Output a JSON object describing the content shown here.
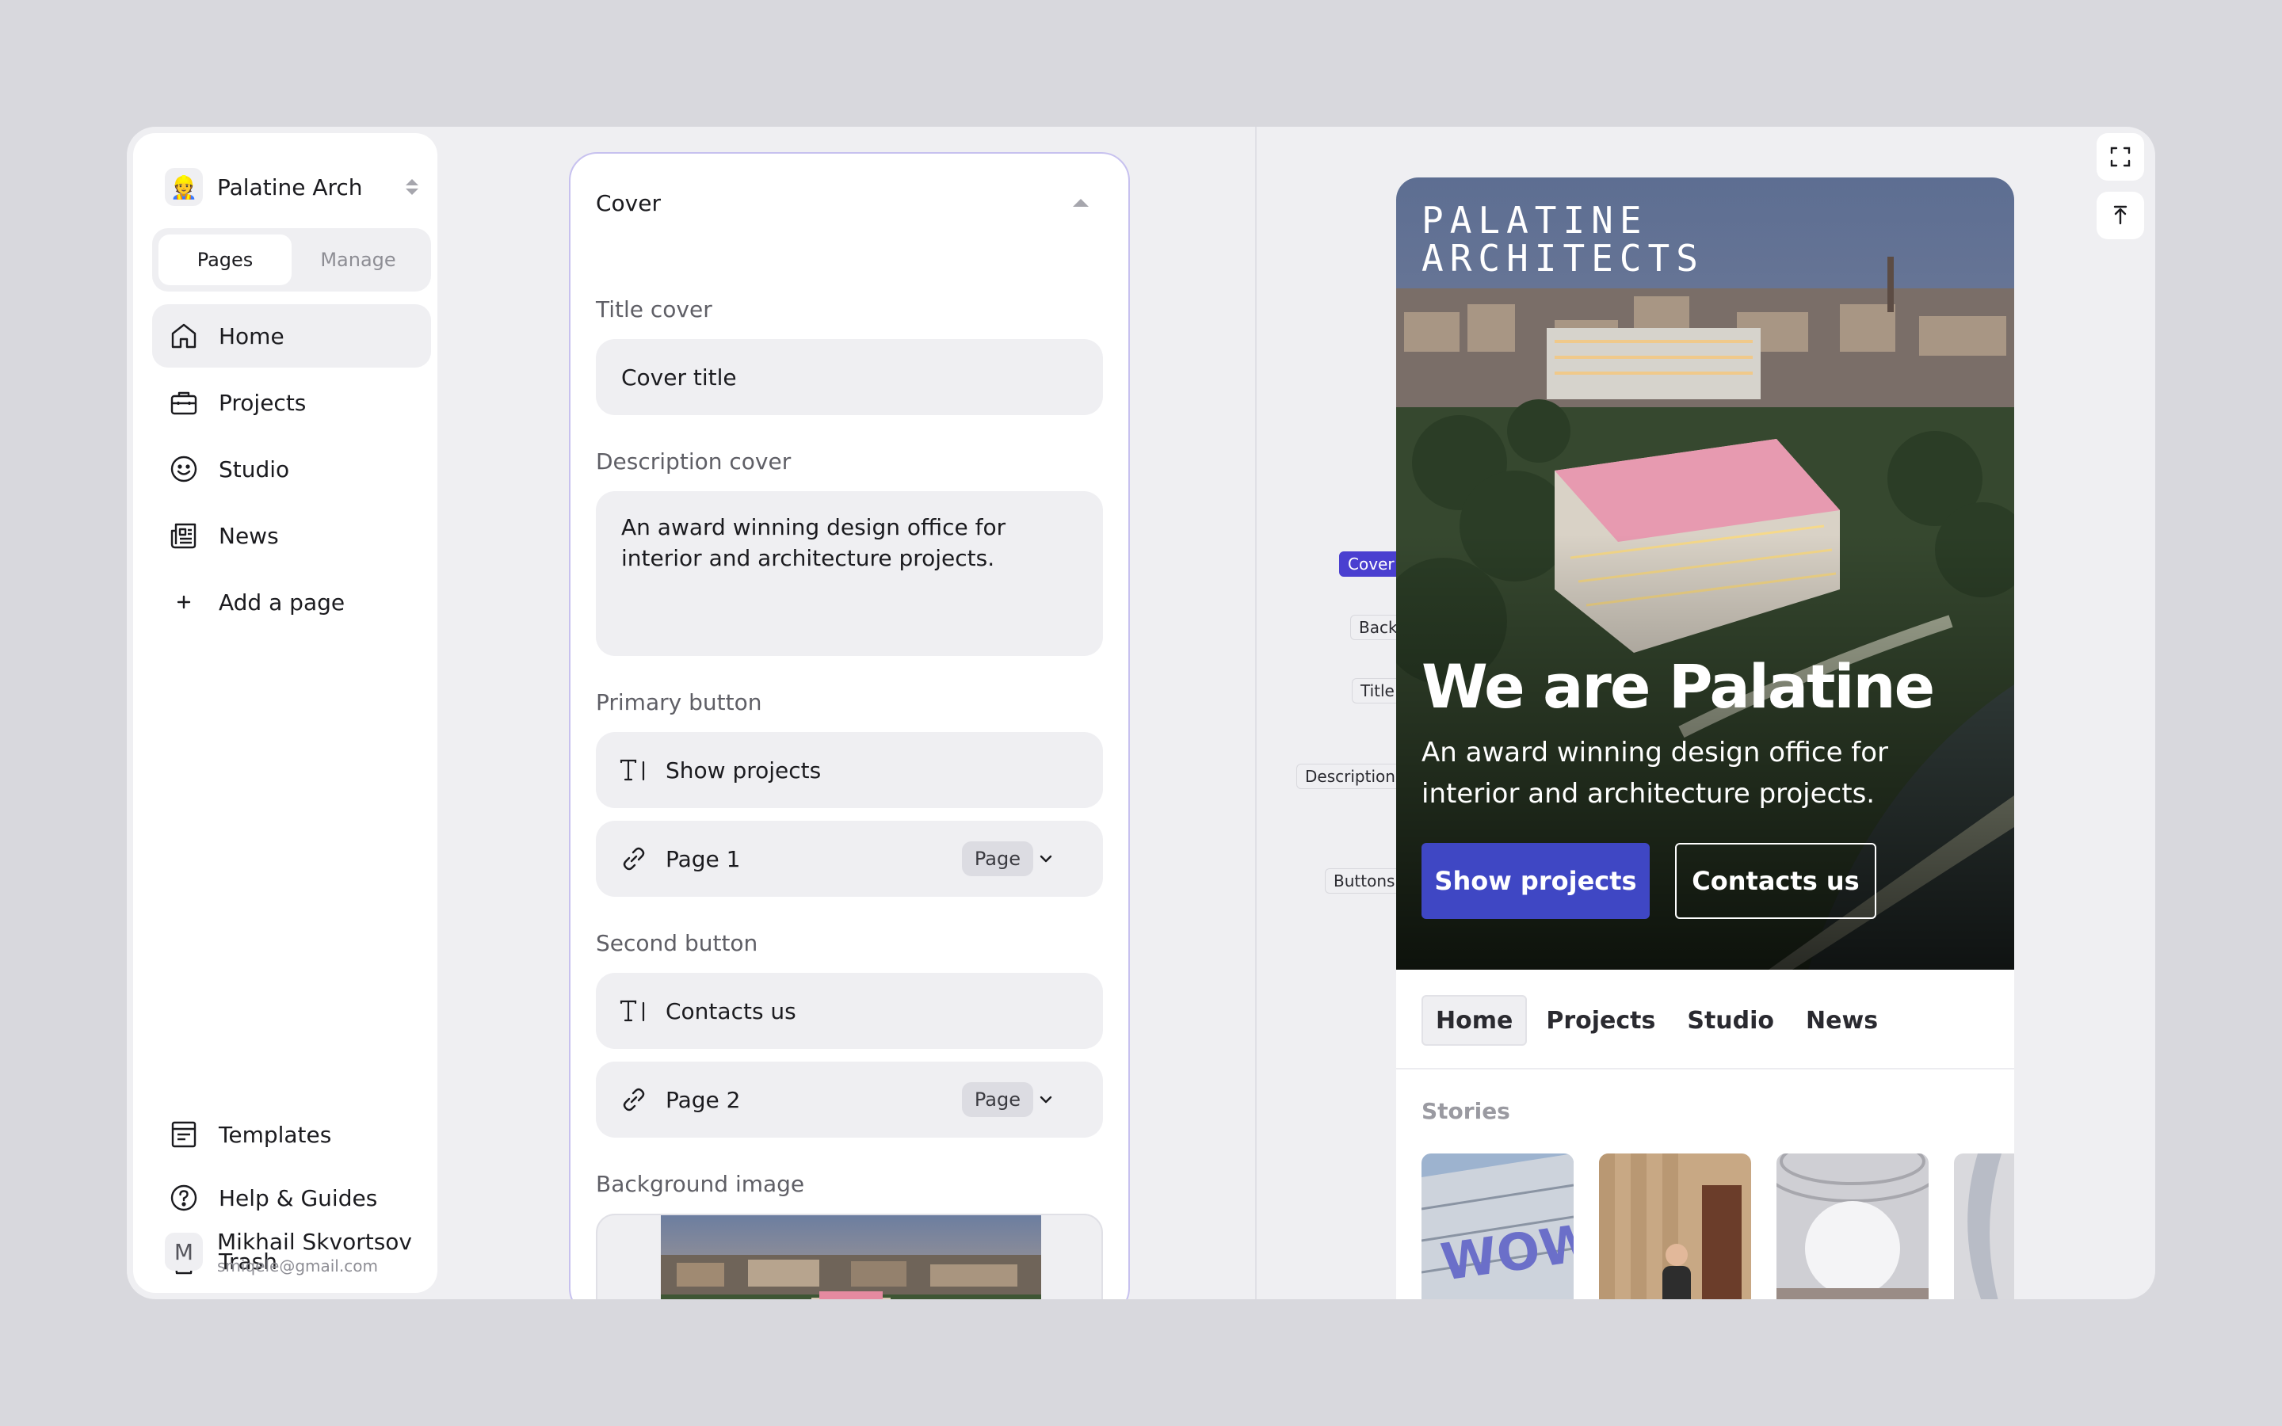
{
  "workspace": {
    "name": "Palatine Arch",
    "logo_emoji": "👷"
  },
  "tabs": {
    "pages": "Pages",
    "manage": "Manage"
  },
  "sidebar": {
    "items": [
      {
        "label": "Home",
        "icon": "home-icon"
      },
      {
        "label": "Projects",
        "icon": "briefcase-icon"
      },
      {
        "label": "Studio",
        "icon": "smile-icon"
      },
      {
        "label": "News",
        "icon": "newspaper-icon"
      },
      {
        "label": "Add a page",
        "icon": "plus-icon"
      }
    ],
    "bottom": [
      {
        "label": "Templates",
        "icon": "template-icon"
      },
      {
        "label": "Help & Guides",
        "icon": "help-icon"
      },
      {
        "label": "Trash",
        "icon": "trash-icon"
      }
    ]
  },
  "user": {
    "initial": "M",
    "name": "Mikhail Skvortsov",
    "email": "smiqele@gmail.com"
  },
  "editor": {
    "section_title": "Cover",
    "title_label": "Title cover",
    "title_value": "Cover title",
    "description_label": "Description cover",
    "description_value": "An award winning design office for interior and architecture projects.",
    "primary_label": "Primary button",
    "primary_text": "Show projects",
    "primary_link": "Page 1",
    "primary_link_badge": "Page",
    "second_label": "Second button",
    "second_text": "Contacts us",
    "second_link": "Page 2",
    "second_link_badge": "Page",
    "background_label": "Background image"
  },
  "preview": {
    "brand_line1": "PALATINE",
    "brand_line2": "ARCHITECTS",
    "title": "We are Palatine",
    "description": "An award winning design office for interior and architecture projects.",
    "primary_button": "Show projects",
    "secondary_button": "Contacts us",
    "nav": [
      "Home",
      "Projects",
      "Studio",
      "News"
    ],
    "stories_title": "Stories",
    "story_sign_text": "WOW"
  },
  "section_tags": {
    "cover": "Cover",
    "back": "Back",
    "title": "Title",
    "description": "Description",
    "buttons": "Buttons"
  },
  "colors": {
    "accent": "#4a3fd0",
    "primary_button": "#3f47c4",
    "editor_border": "#c7c1ef"
  }
}
